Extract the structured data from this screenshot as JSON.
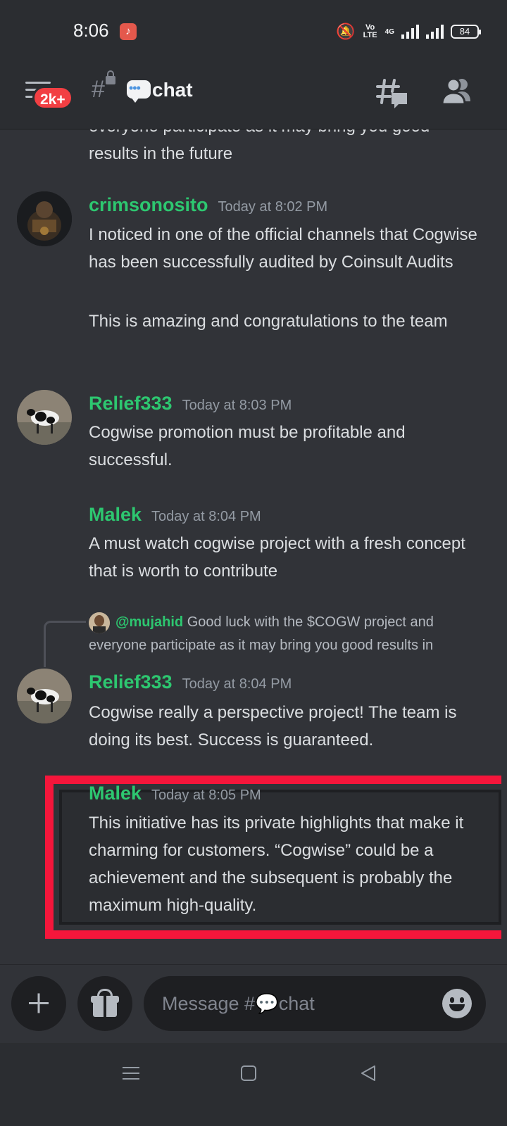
{
  "status_bar": {
    "time": "8:06",
    "network_volte": "Vo\nLTE",
    "network_type": "4G",
    "battery": "84"
  },
  "header": {
    "unread_badge": "2k+",
    "channel_name": "chat",
    "icons": [
      "menu-icon",
      "locked-channel-icon",
      "speech-bubble-emoji",
      "threads-icon",
      "members-icon"
    ]
  },
  "messages": [
    {
      "continuation_text": "everyone participate as it may bring you good results in the future"
    },
    {
      "username": "crimsonosito",
      "timestamp": "Today at 8:02 PM",
      "paragraphs": [
        "I noticed in one of the official channels that Cogwise has been  successfully audited by Coinsult Audits",
        "This is amazing and congratulations to the team"
      ]
    },
    {
      "username": "Relief333",
      "timestamp": "Today at 8:03 PM",
      "paragraphs": [
        "Cogwise promotion must be profitable and successful."
      ]
    },
    {
      "username": "Malek",
      "timestamp": "Today at 8:04 PM",
      "paragraphs": [
        "A must watch cogwise project with a fresh concept that is worth to contribute"
      ]
    },
    {
      "reply_to": {
        "mention": "@mujahid",
        "text": "Good luck with the $COGW project and everyone participate as it may bring you good results in"
      },
      "username": "Relief333",
      "timestamp": "Today at 8:04 PM",
      "paragraphs": [
        "Cogwise really a perspective project! The team is doing its best. Success is guaranteed."
      ]
    },
    {
      "username": "Malek",
      "timestamp": "Today at 8:05 PM",
      "paragraphs": [
        "This initiative has its private highlights that make it charming for customers. “Cogwise” could be a achievement and the subsequent is probably the maximum high-quality."
      ]
    }
  ],
  "composer": {
    "placeholder": "Message #💬chat"
  },
  "colors": {
    "background": "#313338",
    "header_bg": "#2b2d31",
    "username_green": "#2dc770",
    "timestamp_gray": "#949ba4",
    "badge_red": "#f23f43",
    "highlight_red": "#f5163b"
  }
}
